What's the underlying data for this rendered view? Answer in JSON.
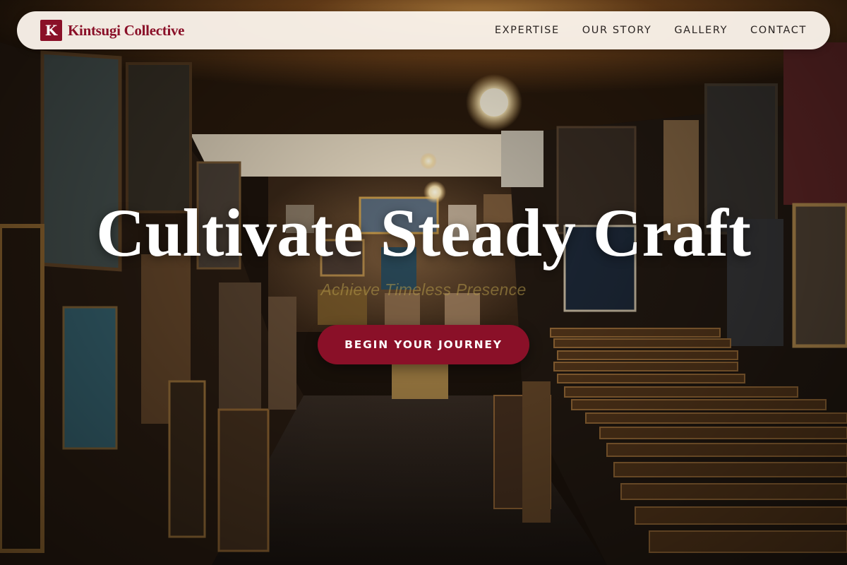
{
  "brand": {
    "mark": "K",
    "name": "Kintsugi Collective",
    "color": "#8a1028"
  },
  "nav": {
    "links": [
      "EXPERTISE",
      "OUR STORY",
      "GALLERY",
      "CONTACT"
    ]
  },
  "hero": {
    "title": "Cultivate Steady Craft",
    "subtitle": "Achieve Timeless Presence",
    "cta_label": "BEGIN YOUR JOURNEY",
    "cta_color": "#8a1028"
  },
  "background": {
    "description_icon": "art-gallery-photo",
    "accent": "#c8782a"
  }
}
